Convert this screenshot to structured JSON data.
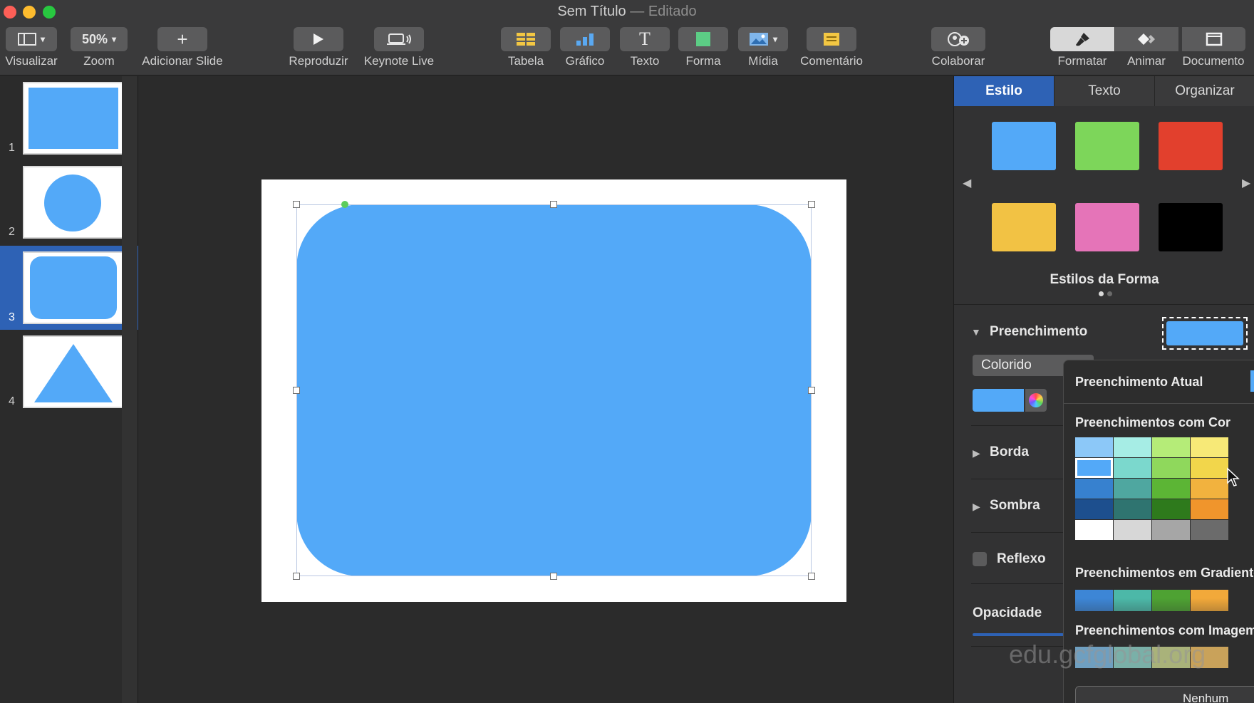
{
  "window": {
    "title": "Sem Título",
    "separator": " — ",
    "status": "Editado"
  },
  "toolbar": {
    "view": {
      "label": "Visualizar",
      "icon": "sidebar-icon"
    },
    "zoom": {
      "label": "Zoom",
      "value": "50%"
    },
    "add_slide": {
      "label": "Adicionar Slide",
      "icon": "plus-icon"
    },
    "play": {
      "label": "Reproduzir",
      "icon": "play-icon"
    },
    "keynote_live": {
      "label": "Keynote Live",
      "icon": "broadcast-icon"
    },
    "table": {
      "label": "Tabela",
      "icon": "table-icon"
    },
    "chart": {
      "label": "Gráfico",
      "icon": "bar-chart-icon"
    },
    "text": {
      "label": "Texto",
      "icon": "text-icon",
      "glyph": "T"
    },
    "shape": {
      "label": "Forma",
      "icon": "shape-icon"
    },
    "media": {
      "label": "Mídia",
      "icon": "image-icon"
    },
    "comment": {
      "label": "Comentário",
      "icon": "comment-icon"
    },
    "collaborate": {
      "label": "Colaborar",
      "icon": "collaborate-icon"
    },
    "format": {
      "label": "Formatar",
      "icon": "paintbrush-icon"
    },
    "animate": {
      "label": "Animar",
      "icon": "diamond-icon"
    },
    "document": {
      "label": "Documento",
      "icon": "document-icon"
    }
  },
  "navigator": {
    "slides": [
      {
        "number": "1",
        "shape": "rectangle"
      },
      {
        "number": "2",
        "shape": "circle"
      },
      {
        "number": "3",
        "shape": "rounded-rectangle",
        "selected": true
      },
      {
        "number": "4",
        "shape": "triangle"
      }
    ]
  },
  "inspector": {
    "tabs": [
      "Estilo",
      "Texto",
      "Organizar"
    ],
    "active_tab": "Estilo",
    "shape_styles_label": "Estilos da Forma",
    "style_swatches": [
      "#53a9f8",
      "#7dd65a",
      "#e2402d",
      "#f2c244",
      "#e574b8",
      "#000000"
    ],
    "fill": {
      "label": "Preenchimento",
      "type_value": "Colorido",
      "current_color": "#53a9f8"
    },
    "border_label": "Borda",
    "shadow_label": "Sombra",
    "reflection_label": "Reflexo",
    "opacity_label": "Opacidade"
  },
  "popover": {
    "current_fill_label": "Preenchimento Atual",
    "color_fills_label": "Preenchimentos com Cor",
    "gradient_fills_label": "Preenchimentos em Gradiente",
    "image_fills_label": "Preenchimentos com Imagem",
    "none_button": "Nenhum",
    "color_grid": [
      [
        "#8cc8f8",
        "#a6ede5",
        "#b5ec78",
        "#f7e977"
      ],
      [
        "#53a9f8",
        "#7bd8cd",
        "#8fd85c",
        "#f2d64b"
      ],
      [
        "#3781cf",
        "#4fa7a0",
        "#5cb535",
        "#f2b23e"
      ],
      [
        "#1d4f8e",
        "#2f7470",
        "#2e7a1c",
        "#f0952c"
      ],
      [
        "#ffffff",
        "#d7d7d7",
        "#a6a6a6",
        "#6b6b6b"
      ]
    ],
    "gradient_row": [
      "#3d86d6",
      "#4cb8a8",
      "#4ea233",
      "#f2a93a"
    ],
    "image_row": [
      "#6f9fc0",
      "#7ab0a8",
      "#a9b27a",
      "#c9a25a"
    ]
  },
  "watermark": "edu.gcfglobal.org"
}
